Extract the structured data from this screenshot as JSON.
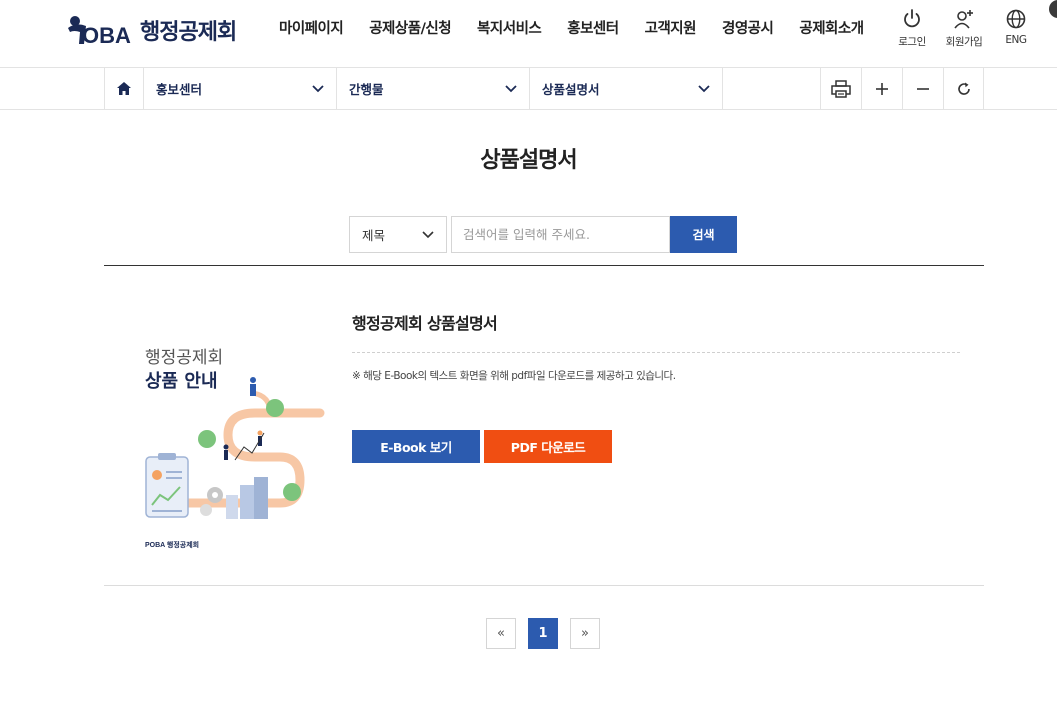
{
  "header": {
    "logo_text": "행정공제회",
    "logo_mark": "POBA",
    "nav": [
      "마이페이지",
      "공제상품/신청",
      "복지서비스",
      "홍보센터",
      "고객지원",
      "경영공시",
      "공제회소개"
    ],
    "util": [
      {
        "label": "로그인",
        "icon": "power-icon"
      },
      {
        "label": "회원가입",
        "icon": "user-plus-icon"
      },
      {
        "label": "ENG",
        "icon": "globe-icon"
      }
    ]
  },
  "location": {
    "home_icon": "home-icon",
    "depth1": "홍보센터",
    "depth2": "간행물",
    "depth3": "상품설명서",
    "tools": [
      "print-icon",
      "zoom-in-icon",
      "zoom-out-icon",
      "refresh-icon"
    ]
  },
  "page": {
    "title": "상품설명서"
  },
  "search": {
    "field_selected": "제목",
    "placeholder": "검색어를 입력해 주세요.",
    "button": "검색"
  },
  "item": {
    "title": "행정공제회 상품설명서",
    "note": "※ 해당 E-Book의 텍스트 화면을 위해 pdf파일 다운로드를 제공하고 있습니다.",
    "ebook_button": "E-Book 보기",
    "pdf_button": "PDF 다운로드",
    "thumb": {
      "line1": "행정공제회",
      "line2": "상품 안내",
      "footer": "POBA 행정공제회"
    }
  },
  "pagination": {
    "prev": "«",
    "current": "1",
    "next": "»"
  },
  "colors": {
    "primary": "#2c5baf",
    "pdf": "#f04e12",
    "navy": "#1b2a55"
  }
}
